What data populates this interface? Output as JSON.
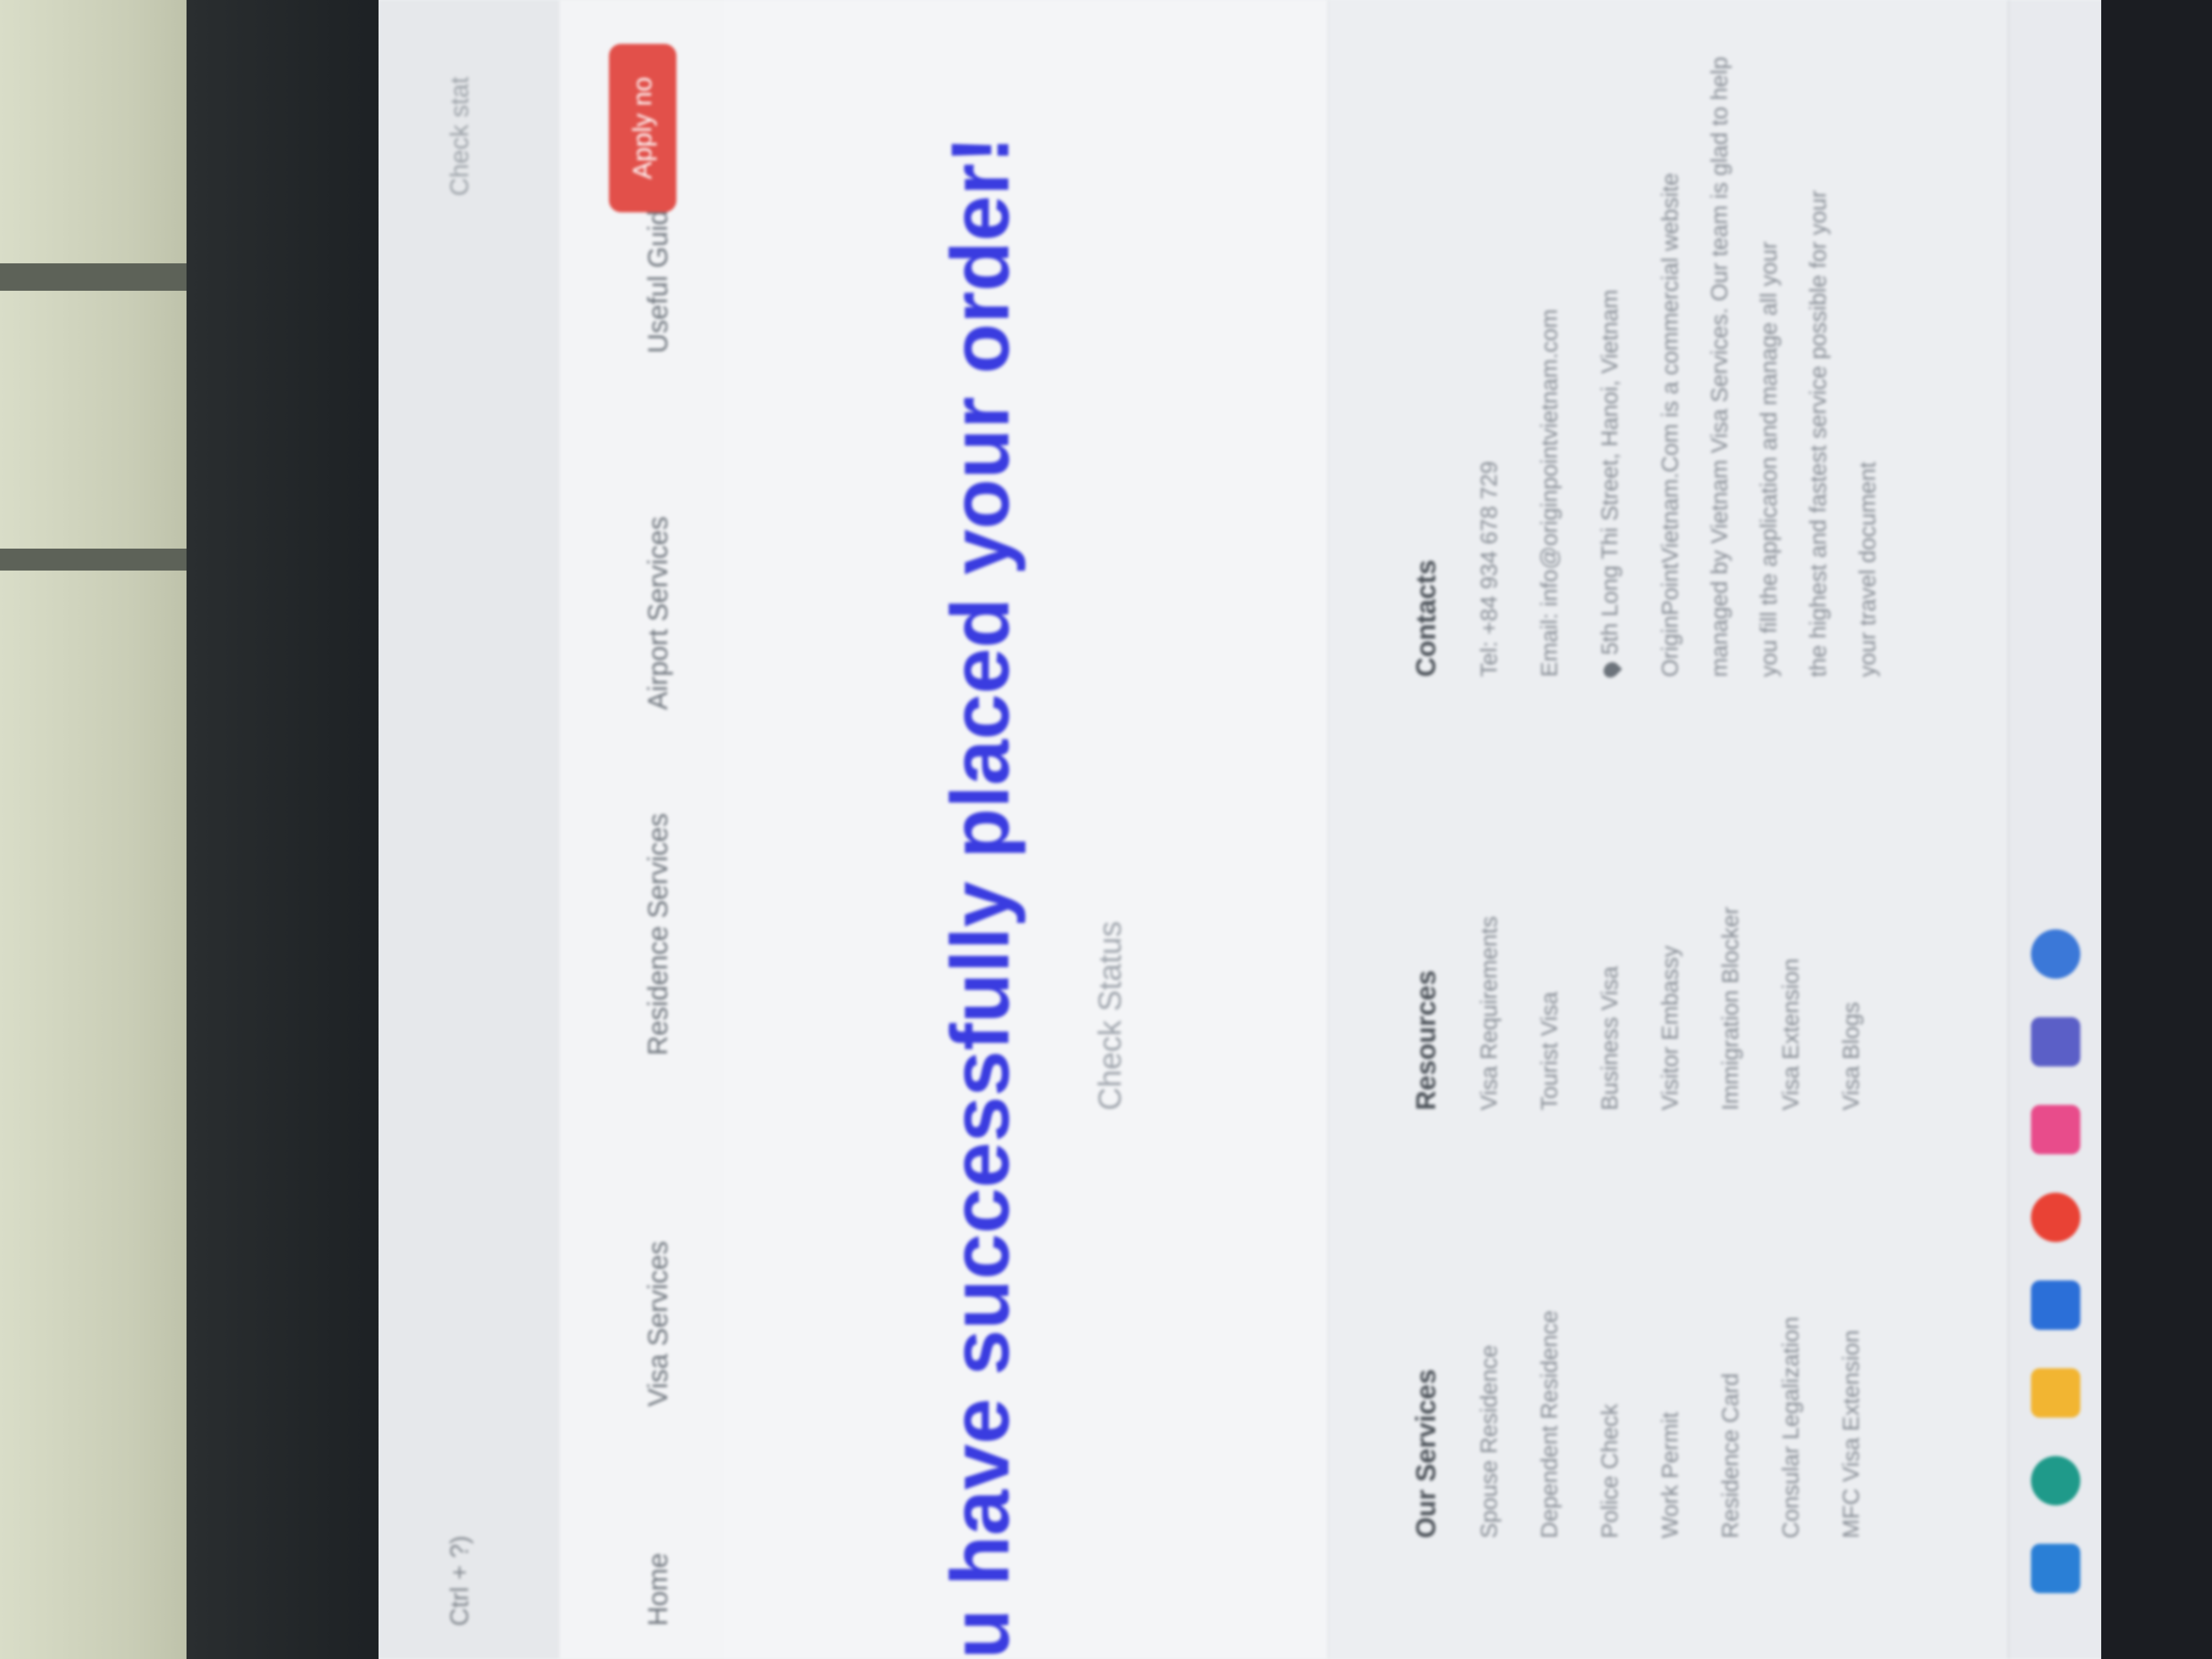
{
  "browser": {
    "url": "Ctrl + ?)",
    "header_right": "Check stat"
  },
  "nav": {
    "items": [
      "Home",
      "Visa Services",
      "Residence Services",
      "Airport Services",
      "Useful Guides"
    ],
    "apply_label": "Apply no"
  },
  "hero": {
    "title": "u have successfully placed your order!",
    "check_status": "Check Status"
  },
  "footer": {
    "services": {
      "title": "Our Services",
      "items": [
        "Spouse Residence",
        "Dependent Residence",
        "Police Check",
        "Work Permit",
        "Residence Card",
        "Consular Legalization",
        "MFC Visa Extension"
      ]
    },
    "resources": {
      "title": "Resources",
      "items": [
        "Visa Requirements",
        "Tourist Visa",
        "Business Visa",
        "Visitor Embassy",
        "Immigration Blocker",
        "Visa Extension",
        "Visa Blogs"
      ]
    },
    "contacts": {
      "title": "Contacts",
      "tel": "Tel: +84 934 678 729",
      "email": "Email: info@originpointvietnam.com",
      "address": "5th Long Thi Street, Hanoi, Vietnam",
      "description": [
        "OriginPointVietnam.Com is a commercial website",
        "managed by Vietnam Visa Services. Our team is glad to help",
        "you fill the application and manage all your",
        "the highest and fastest service possible for your",
        "your travel document"
      ]
    }
  },
  "taskbar": {
    "icons": [
      "windows-icon",
      "edge-icon",
      "file-explorer-icon",
      "app-icon",
      "chrome-icon",
      "store-icon",
      "teams-icon",
      "settings-icon"
    ]
  }
}
